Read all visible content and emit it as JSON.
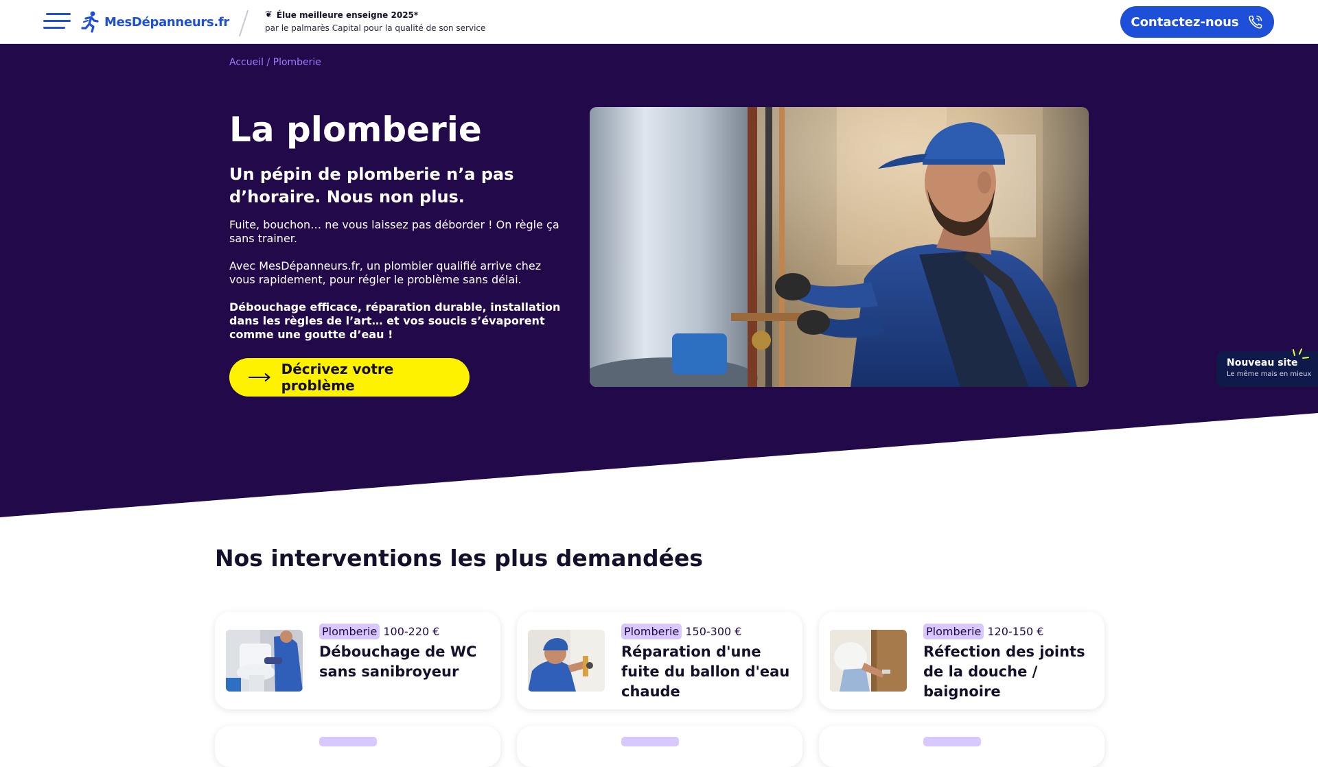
{
  "header": {
    "logo_text": "MesDépanneurs.fr",
    "award_title": "Élue meilleure enseigne 2025*",
    "award_subtitle": "par le palmarès Capital pour la qualité de son service",
    "contact_label": "Contactez-nous"
  },
  "hero": {
    "breadcrumb": [
      "Accueil",
      "Plomberie"
    ],
    "breadcrumb_sep": "/",
    "title": "La plomberie",
    "subtitle": "Un pépin de plomberie n’a pas d’horaire. Nous non plus.",
    "paragraphs": [
      "Fuite, bouchon… ne vous laissez pas déborder ! On règle ça sans trainer.",
      "Avec MesDépanneurs.fr, un plombier qualifié arrive chez vous rapidement, pour régler le problème sans délai.",
      "Débouchage efficace, réparation durable, installation dans les règles de l’art… et vos soucis s’évaporent comme une goutte d’eau !"
    ],
    "cta_label": "Décrivez votre problème"
  },
  "new_site_badge": {
    "title": "Nouveau site",
    "subtitle": "Le même mais en mieux"
  },
  "interventions": {
    "title": "Nos interventions les plus demandées",
    "cards": [
      {
        "tag": "Plomberie",
        "price": "100-220 €",
        "title": "Débouchage de WC sans sanibroyeur"
      },
      {
        "tag": "Plomberie",
        "price": "150-300 €",
        "title": "Réparation d'une fuite du ballon d'eau chaude"
      },
      {
        "tag": "Plomberie",
        "price": "120-150 €",
        "title": "Réfection des joints de la douche / baignoire"
      }
    ]
  },
  "colors": {
    "brand_blue": "#1d4fd8",
    "hero_bg": "#22094a",
    "cta_yellow": "#fff200",
    "tag_bg": "#d9c8ff",
    "breadcrumb": "#9c7bff"
  },
  "icons": [
    "menu-icon",
    "runner-logo-icon",
    "laurel-icon",
    "phone-icon",
    "arrow-right-icon",
    "sparkle-icon"
  ]
}
